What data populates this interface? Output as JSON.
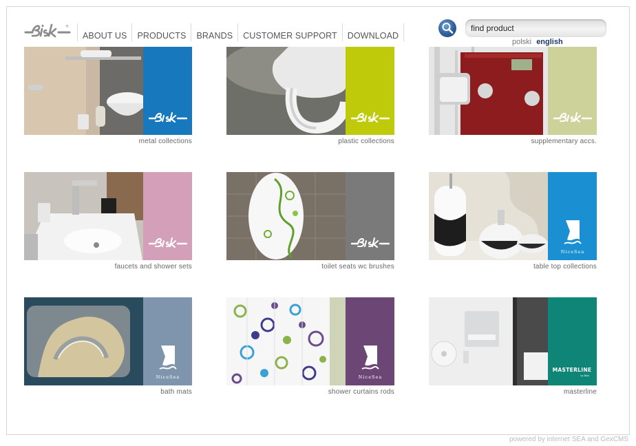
{
  "header": {
    "logo_text": "Bisk",
    "nav": [
      "ABOUT US",
      "PRODUCTS",
      "BRANDS",
      "CUSTOMER SUPPORT",
      "DOWNLOAD"
    ],
    "search_placeholder": "find product",
    "search_icon": "magnifier-icon",
    "languages": {
      "polski": "polski",
      "english": "english"
    }
  },
  "tiles": [
    {
      "caption": "metal collections",
      "brand": "Bisk",
      "accent": "#1878bd"
    },
    {
      "caption": "plastic collections",
      "brand": "Bisk",
      "accent": "#bfca0b"
    },
    {
      "caption": "supplementary accs.",
      "brand": "Bisk",
      "accent": "#cdd29a"
    },
    {
      "caption": "faucets and shower sets",
      "brand": "Bisk",
      "accent": "#d49fb8"
    },
    {
      "caption": "toilet seats wc brushes",
      "brand": "Bisk",
      "accent": "#7a7a7a"
    },
    {
      "caption": "table top collections",
      "brand": "NiceSea",
      "accent": "#1a8fd2"
    },
    {
      "caption": "bath mats",
      "brand": "NiceSea",
      "accent": "#7f95ad"
    },
    {
      "caption": "shower curtains rods",
      "brand": "NiceSea",
      "accent": "#6c4776"
    },
    {
      "caption": "masterline",
      "brand": "MASTERLINE",
      "brand_sub": "by Bisk",
      "accent": "#0f8578"
    }
  ],
  "footer": {
    "text": "powered by internet SEA and GexCMS"
  }
}
